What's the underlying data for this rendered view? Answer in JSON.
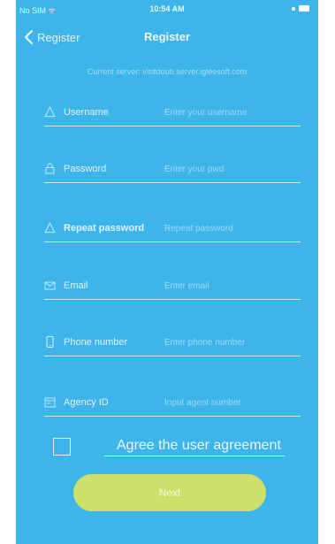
{
  "status_bar": {
    "carrier": "No SIM ᯤ",
    "time": "10:54 AM"
  },
  "navbar": {
    "back_label": "Register",
    "title": "Register"
  },
  "server_note": "Current server: visitdoub.server.igleesoft.com",
  "fields": [
    {
      "label": "Username",
      "placeholder": "Enter your username",
      "icon": "user-icon"
    },
    {
      "label": "Password",
      "placeholder": "Enter your pwd",
      "icon": "lock-icon"
    },
    {
      "label": "Repeat password",
      "placeholder": "Repeat password",
      "icon": "lock-icon"
    },
    {
      "label": "Email",
      "placeholder": "Enter email",
      "icon": "mail-icon"
    },
    {
      "label": "Phone number",
      "placeholder": "Enter phone number",
      "icon": "phone-icon"
    },
    {
      "label": "Agency ID",
      "placeholder": "Input agent number",
      "icon": "id-card-icon"
    }
  ],
  "agreement": {
    "label": "Agree the user agreement",
    "checked": false
  },
  "next_button": {
    "label": "Next"
  },
  "colors": {
    "background": "#3db4ea",
    "next_button": "#cfe06a",
    "text": "#ffffff"
  }
}
